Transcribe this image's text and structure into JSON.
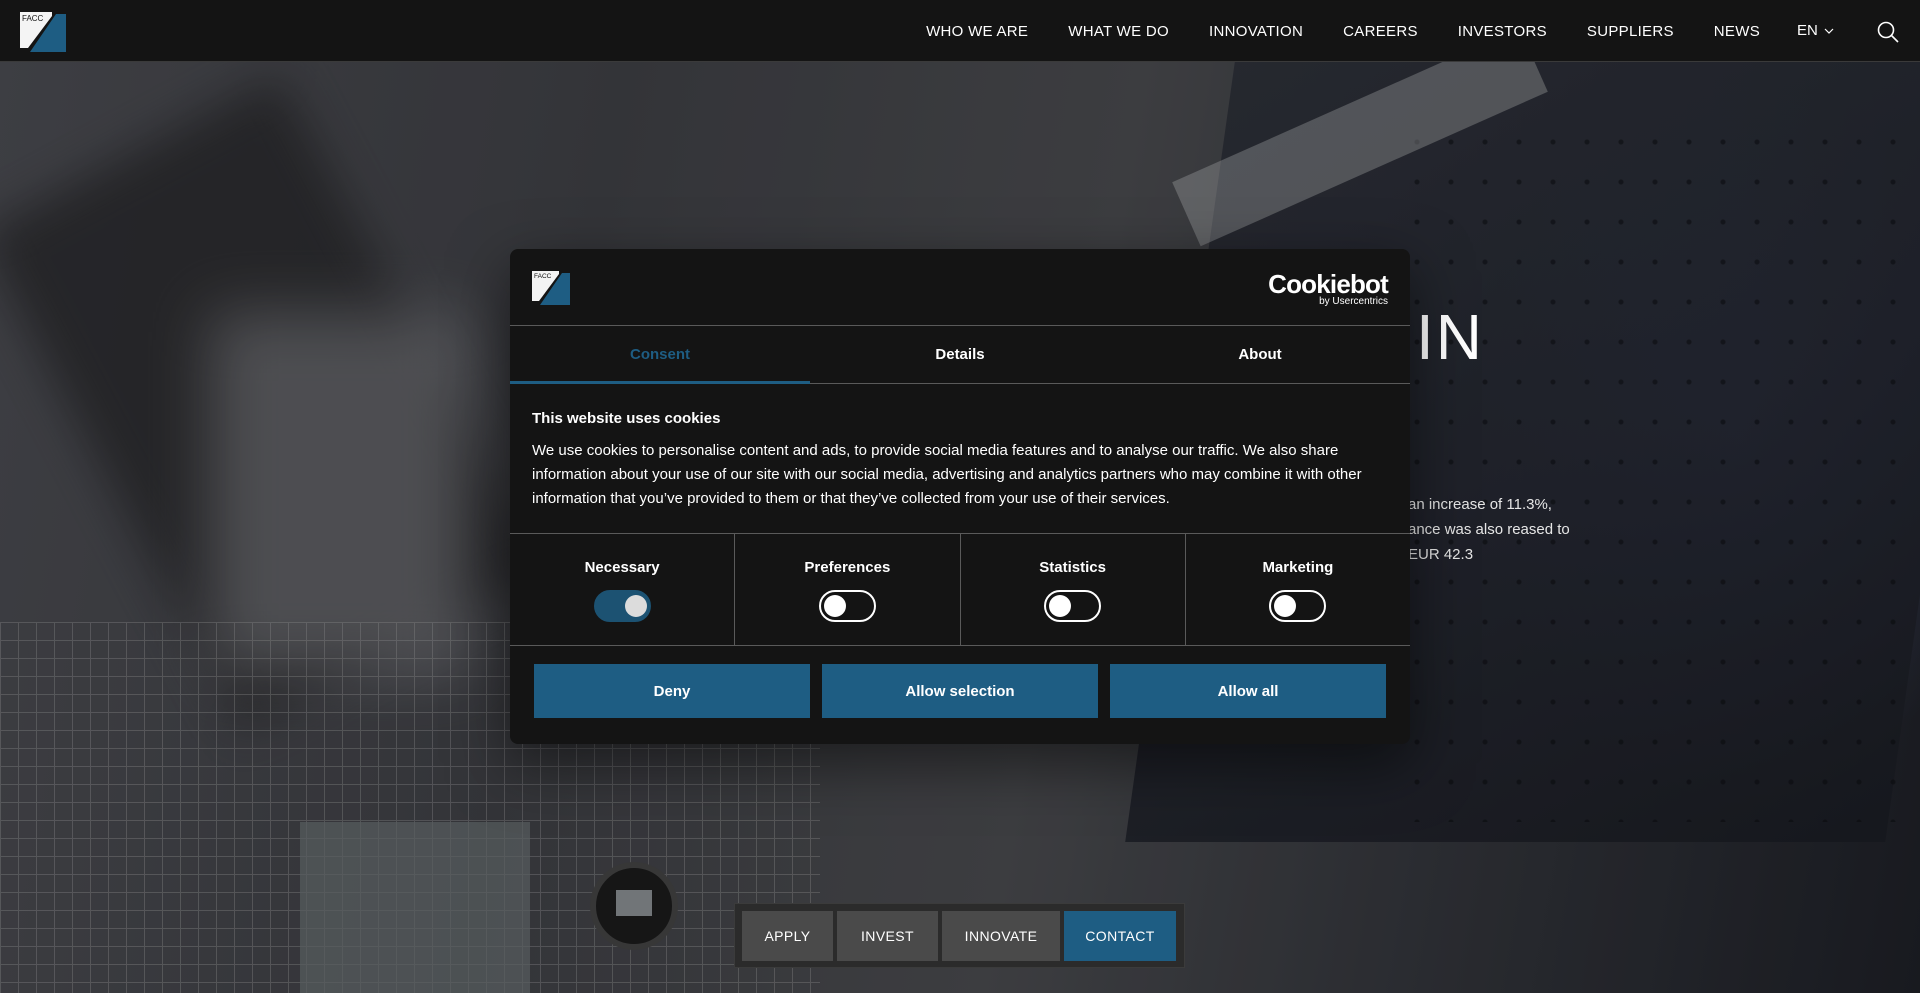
{
  "header": {
    "logo_text": "FACC",
    "nav": [
      "WHO WE ARE",
      "WHAT WE DO",
      "INNOVATION",
      "CAREERS",
      "INVESTORS",
      "SUPPLIERS",
      "NEWS"
    ],
    "language": "EN",
    "icons": {
      "language_dropdown": "chevron-down-icon",
      "search": "search-icon"
    }
  },
  "hero": {
    "title_fragment": "IN",
    "text_fragment": "an increase of 11.3%, ance was also reased to EUR 42.3"
  },
  "cookie_dialog": {
    "logo_text": "FACC",
    "brand": "Cookiebot",
    "brand_sub": "by Usercentrics",
    "tabs": [
      "Consent",
      "Details",
      "About"
    ],
    "active_tab": "Consent",
    "heading": "This website uses cookies",
    "body": "We use cookies to personalise content and ads, to provide social media features and to analyse our traffic. We also share information about your use of our site with our social media, advertising and analytics partners who may combine it with other information that you’ve provided to them or that they’ve collected from your use of their services.",
    "toggles": [
      {
        "label": "Necessary",
        "on": true
      },
      {
        "label": "Preferences",
        "on": false
      },
      {
        "label": "Statistics",
        "on": false
      },
      {
        "label": "Marketing",
        "on": false
      }
    ],
    "buttons": [
      "Deny",
      "Allow selection",
      "Allow all"
    ]
  },
  "cta_bar": [
    "APPLY",
    "INVEST",
    "INNOVATE",
    "CONTACT"
  ],
  "colors": {
    "accent": "#1e5d83",
    "header_bg": "#141414",
    "dialog_bg": "#141414",
    "cta_bg": "#4a4a4a"
  }
}
